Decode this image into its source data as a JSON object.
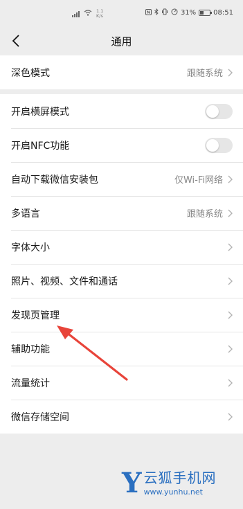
{
  "status_bar": {
    "speed_value": "1.1",
    "speed_unit": "K/s",
    "battery": "31%",
    "time": "08:51"
  },
  "nav": {
    "title": "通用"
  },
  "section1": [
    {
      "label": "深色模式",
      "value": "跟随系统",
      "type": "link"
    }
  ],
  "section2": [
    {
      "label": "开启横屏模式",
      "type": "toggle",
      "on": false
    },
    {
      "label": "开启NFC功能",
      "type": "toggle",
      "on": false
    },
    {
      "label": "自动下载微信安装包",
      "value": "仅Wi-Fi网络",
      "type": "link"
    },
    {
      "label": "多语言",
      "value": "跟随系统",
      "type": "link"
    },
    {
      "label": "字体大小",
      "type": "link"
    },
    {
      "label": "照片、视频、文件和通话",
      "type": "link"
    },
    {
      "label": "发现页管理",
      "type": "link"
    },
    {
      "label": "辅助功能",
      "type": "link"
    },
    {
      "label": "流量统计",
      "type": "link"
    },
    {
      "label": "微信存储空间",
      "type": "link"
    }
  ],
  "colors": {
    "background": "#ededed",
    "card": "#ffffff",
    "arrow": "#e8443a",
    "watermark": "#2a6fc0"
  },
  "watermark": {
    "logo_letter": "Y",
    "name": "云狐手机网",
    "url": "www.yunhu.net"
  }
}
